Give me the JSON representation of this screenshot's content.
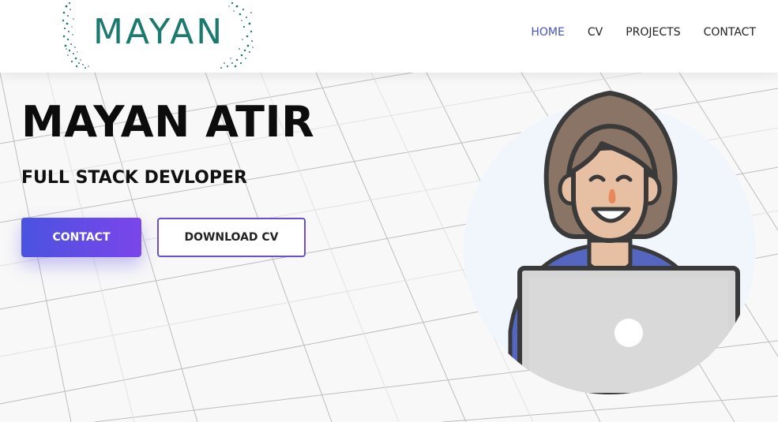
{
  "brand": {
    "logo_text": "MAYAN",
    "logo_color": "#1b7a6e"
  },
  "nav": {
    "items": [
      "HOME",
      "CV",
      "PROJECTS",
      "CONTACT"
    ],
    "active": "HOME",
    "active_color": "#4350c8"
  },
  "hero": {
    "title": "MAYAN ATIR",
    "subtitle": "FULL STACK DEVLOPER",
    "buttons": {
      "contact": "CONTACT",
      "download_cv": "DOWNLOAD CV"
    },
    "accent_gradient": [
      "#4a53e0",
      "#7b45ea"
    ]
  },
  "illustration": {
    "icon": "developer-avatar-with-laptop"
  }
}
